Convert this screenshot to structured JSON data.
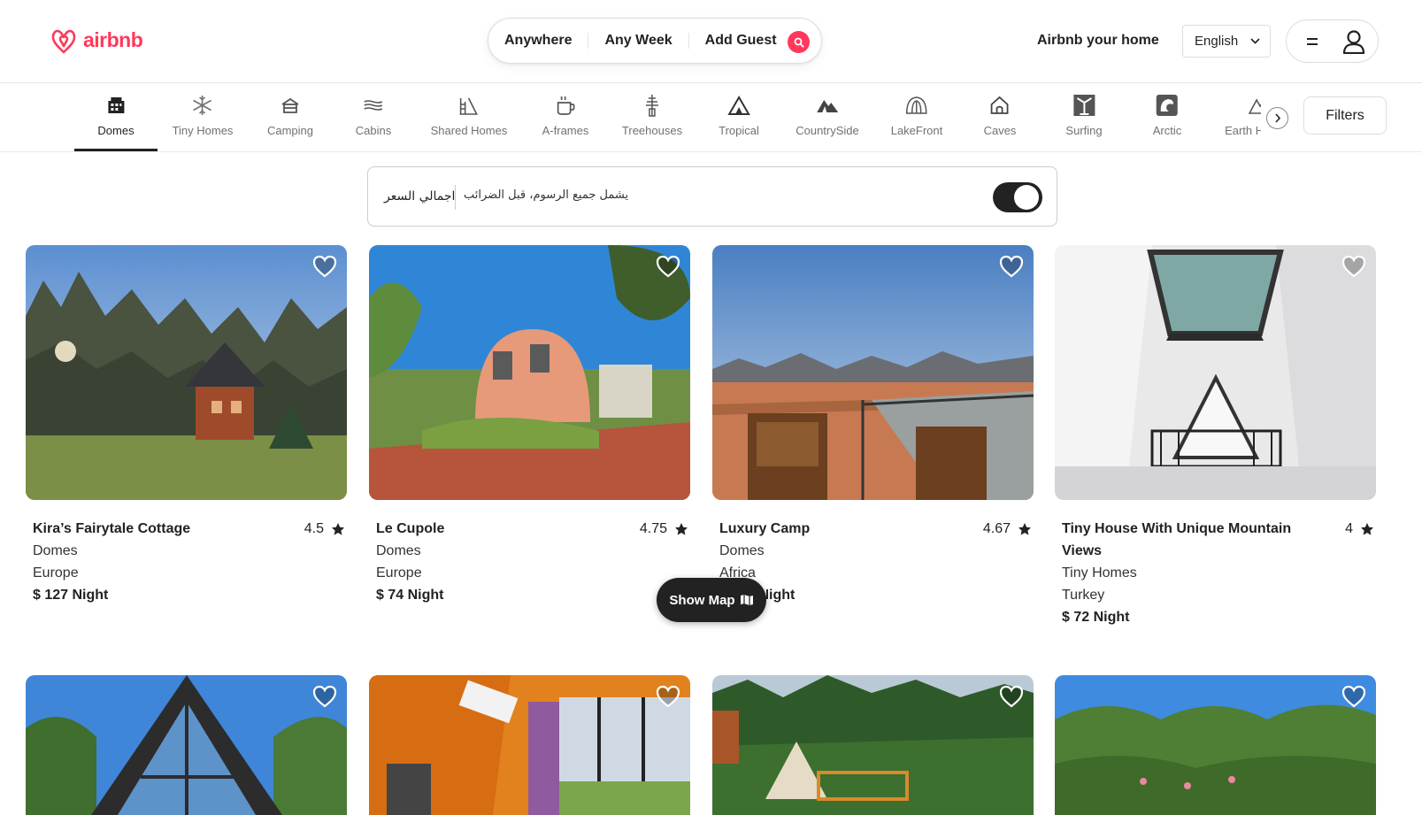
{
  "brand": {
    "name": "airbnb",
    "color": "#ff385c"
  },
  "search": {
    "anywhere": "Anywhere",
    "week": "Any Week",
    "guests": "Add Guest",
    "icon": "search-icon"
  },
  "header": {
    "host_link": "Airbnb your home",
    "language": "English"
  },
  "categories": [
    {
      "label": "Domes",
      "icon": "domes-icon",
      "active": true
    },
    {
      "label": "Tiny Homes",
      "icon": "snowflake-icon"
    },
    {
      "label": "Camping",
      "icon": "camping-icon"
    },
    {
      "label": "Cabins",
      "icon": "cabins-icon"
    },
    {
      "label": "Shared Homes",
      "icon": "shared-homes-icon"
    },
    {
      "label": "A-frames",
      "icon": "a-frames-icon"
    },
    {
      "label": "Treehouses",
      "icon": "treehouse-icon"
    },
    {
      "label": "Tropical",
      "icon": "tropical-icon"
    },
    {
      "label": "CountrySide",
      "icon": "countryside-icon"
    },
    {
      "label": "LakeFront",
      "icon": "lakefront-icon"
    },
    {
      "label": "Caves",
      "icon": "caves-icon"
    },
    {
      "label": "Surfing",
      "icon": "surfing-icon"
    },
    {
      "label": "Arctic",
      "icon": "arctic-icon"
    },
    {
      "label": "Earth Homes",
      "icon": "earth-homes-icon"
    }
  ],
  "filters_label": "Filters",
  "tax": {
    "title": "اجمالي السعر",
    "subtitle": "يشمل جميع الرسوم، قبل الضرائب",
    "enabled": true
  },
  "listings": [
    {
      "title": "Kira’s Fairytale Cottage",
      "rating": "4.5",
      "category": "Domes",
      "location": "Europe",
      "price": "$ 127 Night"
    },
    {
      "title": "Le Cupole",
      "rating": "4.75",
      "category": "Domes",
      "location": "Europe",
      "price": "$ 74 Night"
    },
    {
      "title": "Luxury Camp",
      "rating": "4.67",
      "category": "Domes",
      "location": "Africa",
      "price": "$ 100 Night"
    },
    {
      "title": "Tiny House With Unique Mountain Views",
      "rating": "4",
      "category": "Tiny Homes",
      "location": "Turkey",
      "price": "$ 72 Night"
    }
  ],
  "show_map_label": "Show Map"
}
